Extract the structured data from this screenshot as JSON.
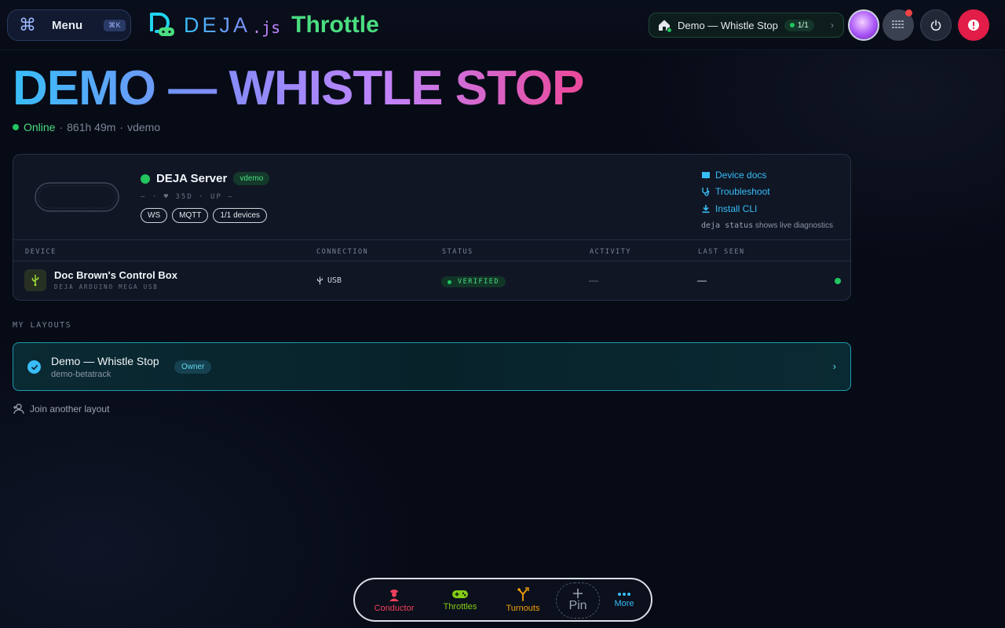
{
  "header": {
    "menu_label": "Menu",
    "menu_shortcut": "⌘K",
    "brand_deja": "DEJA",
    "brand_js": ".js",
    "brand_app": "Throttle",
    "layout_selector": {
      "name": "Demo — Whistle Stop",
      "count": "1/1"
    }
  },
  "hero": {
    "title": "DEMO — WHISTLE STOP",
    "status": "Online",
    "uptime": "861h 49m",
    "user": "vdemo"
  },
  "server": {
    "title": "DEJA Server",
    "tag": "vdemo",
    "meta": "— · ♥ 35D · UP —",
    "chips": [
      "WS",
      "MQTT",
      "1/1 devices"
    ],
    "links": {
      "docs": "Device docs",
      "troubleshoot": "Troubleshoot",
      "install": "Install CLI",
      "hint_cmd": "deja status",
      "hint_text": "shows live diagnostics"
    },
    "table": {
      "headers": [
        "DEVICE",
        "CONNECTION",
        "STATUS",
        "ACTIVITY",
        "LAST SEEN"
      ],
      "rows": [
        {
          "name": "Doc Brown's Control Box",
          "type": "DEJA ARDUINO MEGA USB",
          "connection": "USB",
          "status": "VERIFIED",
          "activity": "—",
          "last_seen": "—"
        }
      ]
    }
  },
  "layouts": {
    "section_label": "MY LAYOUTS",
    "items": [
      {
        "name": "Demo — Whistle Stop",
        "id": "demo-betatrack",
        "role": "Owner"
      }
    ],
    "join_label": "Join another layout"
  },
  "bottom_nav": {
    "items": [
      {
        "label": "Conductor",
        "color": "#f43f5e"
      },
      {
        "label": "Throttles",
        "color": "#84cc16"
      },
      {
        "label": "Turnouts",
        "color": "#f59e0b"
      },
      {
        "label": "Pin",
        "color": "#9ca3af"
      },
      {
        "label": "More",
        "color": "#38bdf8"
      }
    ]
  }
}
